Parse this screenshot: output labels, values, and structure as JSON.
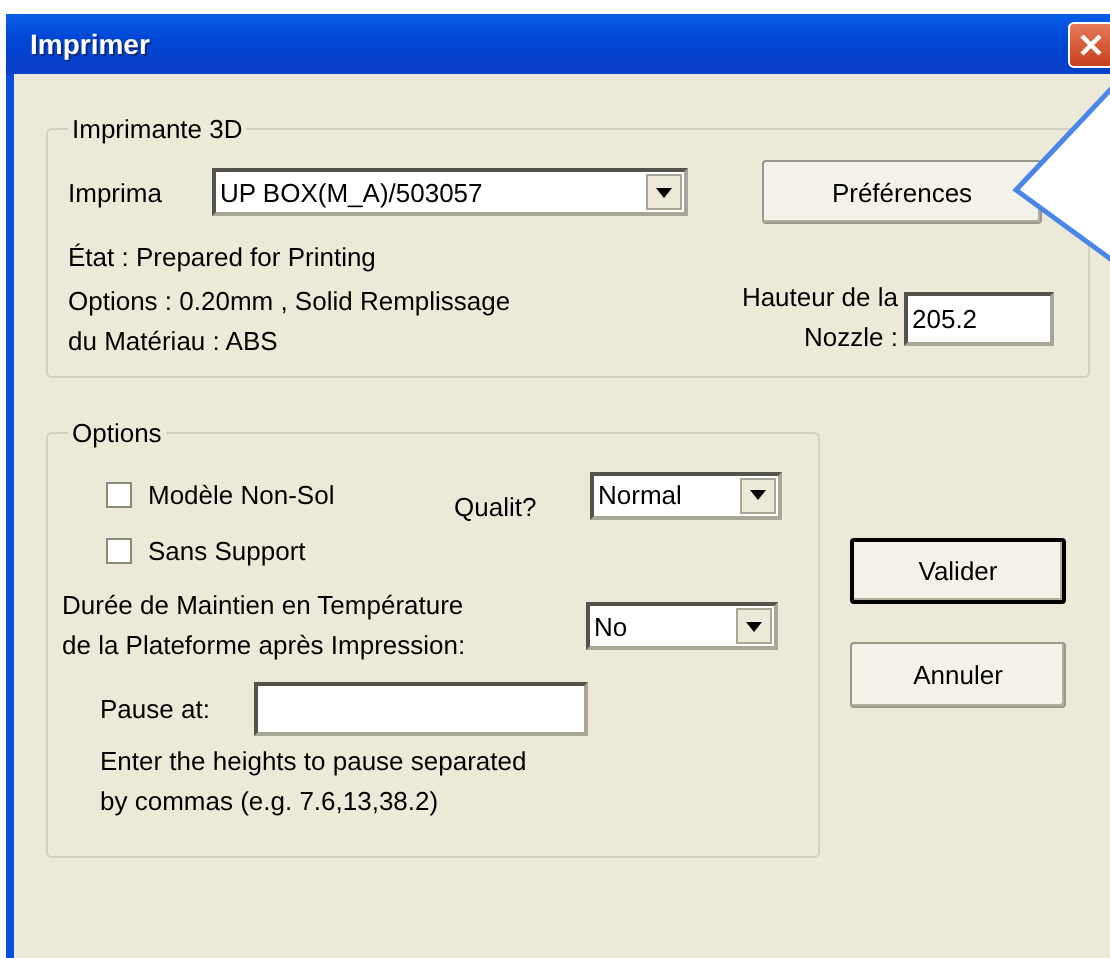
{
  "window": {
    "title": "Imprimer"
  },
  "printer_group": {
    "title": "Imprimante 3D",
    "printer_label": "Imprima",
    "printer_value": "UP BOX(M_A)/503057",
    "preferences_button": "Préférences",
    "status": "État : Prepared for Printing",
    "options_text": [
      "Options : 0.20mm , Solid Remplissage",
      "du Matériau : ABS"
    ],
    "nozzle_label": [
      "Hauteur de la",
      "Nozzle :"
    ],
    "nozzle_value": "205.2"
  },
  "options_group": {
    "title": "Options",
    "checkboxes": [
      {
        "label": "Modèle Non-Sol",
        "checked": false
      },
      {
        "label": "Sans Support",
        "checked": false
      }
    ],
    "quality_label": "Qualit?",
    "quality_value": "Normal",
    "hold_label": [
      "Durée de Maintien en Température",
      "de la Plateforme après Impression:"
    ],
    "hold_value": "No",
    "pause_label": "Pause at:",
    "pause_hint": [
      "Enter the heights to pause separated",
      "by commas (e.g. 7.6,13,38.2)"
    ]
  },
  "buttons": [
    {
      "label": "Valider",
      "default": true
    },
    {
      "label": "Annuler",
      "default": false
    }
  ]
}
